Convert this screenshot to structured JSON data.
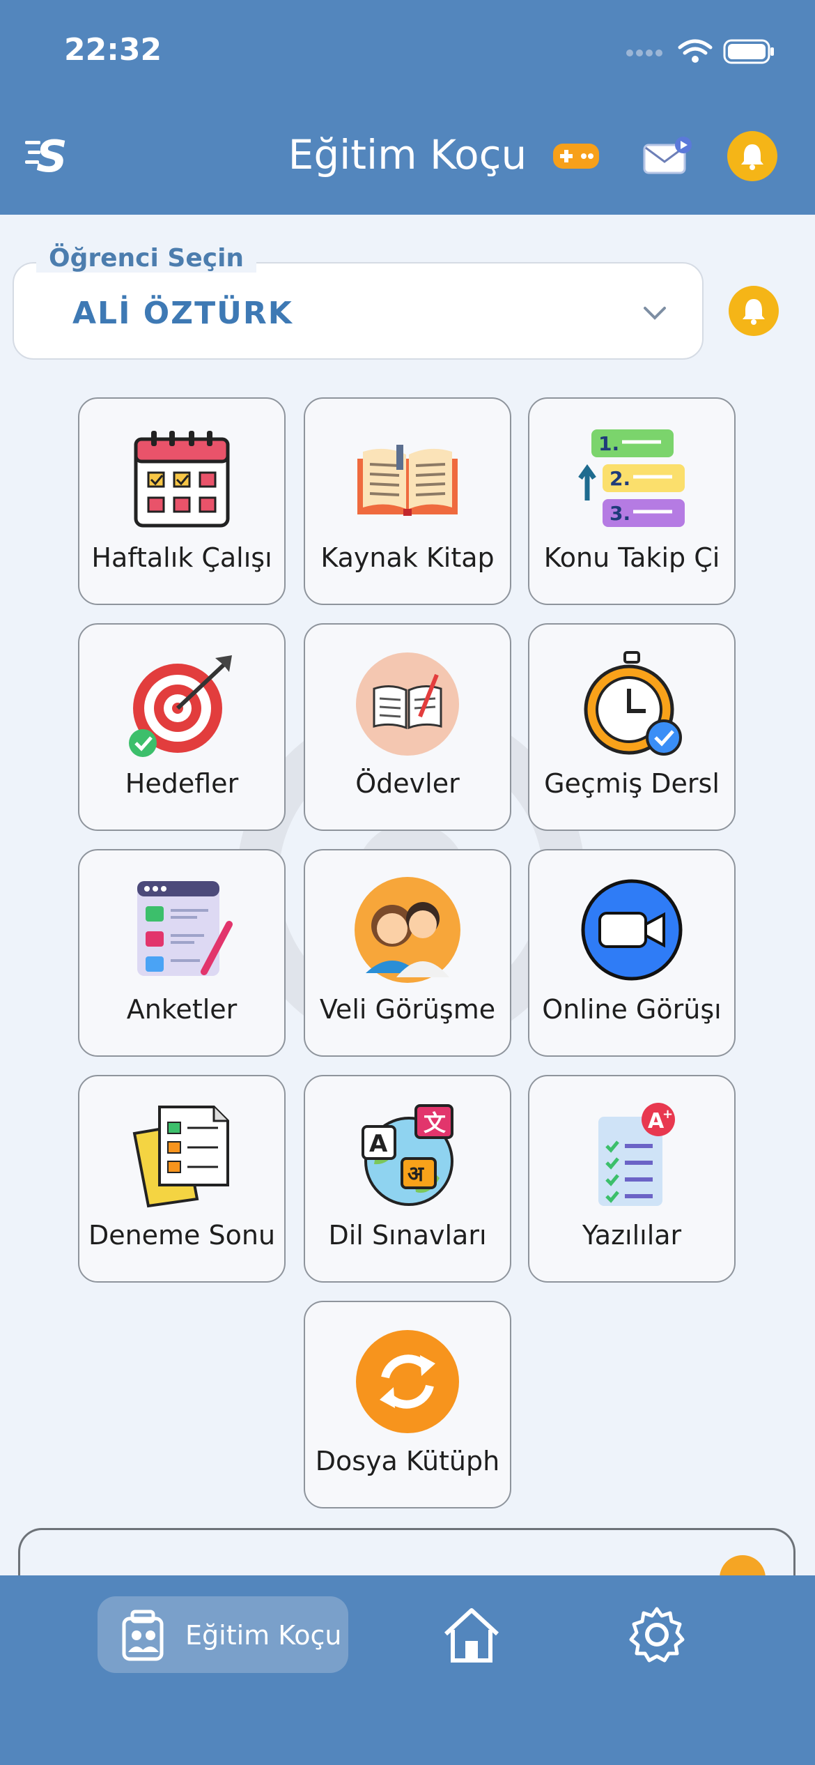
{
  "status_bar": {
    "time": "22:32"
  },
  "header": {
    "title": "Eğitim Koçu",
    "logo_text": "S",
    "icons": [
      "game-controller-icon",
      "mail-icon",
      "bell-icon"
    ]
  },
  "student_selector": {
    "label": "Öğrenci Seçin",
    "selected": "ALİ ÖZTÜRK"
  },
  "menu_tiles": [
    {
      "label": "Haftalık Çalışı",
      "icon": "calendar-icon"
    },
    {
      "label": "Kaynak Kitap",
      "icon": "open-book-icon"
    },
    {
      "label": "Konu Takip Çi",
      "icon": "numbered-list-icon"
    },
    {
      "label": "Hedefler",
      "icon": "target-icon"
    },
    {
      "label": "Ödevler",
      "icon": "homework-book-icon"
    },
    {
      "label": "Geçmiş Dersl",
      "icon": "stopwatch-icon"
    },
    {
      "label": "Anketler",
      "icon": "survey-icon"
    },
    {
      "label": "Veli Görüşme",
      "icon": "parents-icon"
    },
    {
      "label": "Online Görüşı",
      "icon": "video-camera-icon"
    },
    {
      "label": "Deneme Sonu",
      "icon": "exam-results-icon"
    },
    {
      "label": "Dil Sınavları",
      "icon": "language-globe-icon"
    },
    {
      "label": "Yazılılar",
      "icon": "written-exam-icon"
    },
    {
      "label": "Dosya Kütüph",
      "icon": "sync-icon"
    }
  ],
  "bottom_nav": {
    "active_label": "Eğitim Koçu",
    "items": [
      "coach-icon",
      "home-icon",
      "settings-icon"
    ]
  },
  "colors": {
    "primary": "#5386bd",
    "accent_yellow": "#f5b517",
    "orange": "#f7941d",
    "video_blue": "#2f7cf6"
  }
}
